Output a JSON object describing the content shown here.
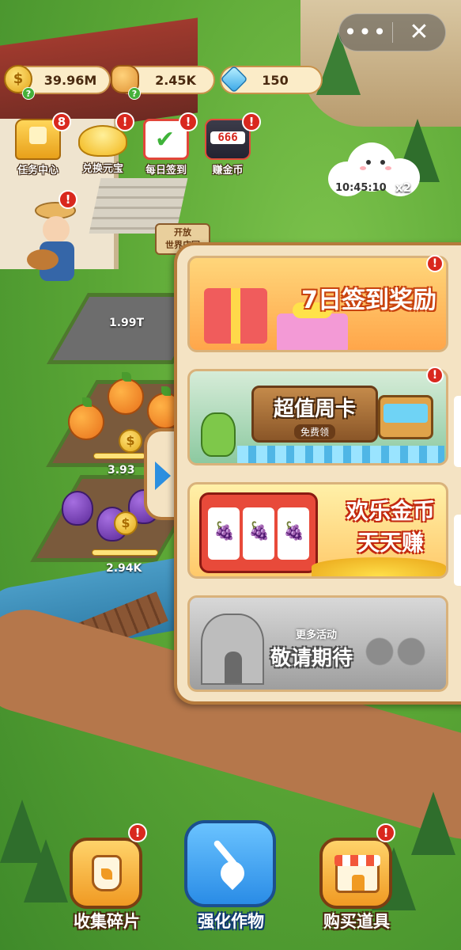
{
  "top_capsule": {
    "more_icon": "more-dots-icon",
    "close_icon": "close-icon"
  },
  "resources": {
    "gold": {
      "value": "39.96M",
      "icon": "gold-coin-icon"
    },
    "fertilizer": {
      "value": "2.45K",
      "icon": "fertilizer-bag-icon"
    },
    "gems": {
      "value": "150",
      "icon": "diamond-icon"
    }
  },
  "hud": [
    {
      "label": "任务中心",
      "badge": "8",
      "icon": "task-chest-icon"
    },
    {
      "label": "兑换元宝",
      "badge": "!",
      "icon": "gold-ingot-icon"
    },
    {
      "label": "每日签到",
      "badge": "!",
      "icon": "calendar-check-icon"
    },
    {
      "label": "赚金币",
      "badge": "!",
      "icon": "slot-machine-icon"
    }
  ],
  "farmer_badge": "!",
  "sign": {
    "line1": "开放",
    "line2": "世界庄园"
  },
  "cloud": {
    "timer": "10:45:10",
    "multiplier": "x2"
  },
  "plots": [
    {
      "value": "1.99T"
    },
    {
      "value": "3.93"
    },
    {
      "value": "2.94K"
    }
  ],
  "panel": {
    "cards": [
      {
        "title": "7日签到奖励",
        "badge": "!"
      },
      {
        "title": "超值周卡",
        "subtitle": "免费领",
        "badge": "!"
      },
      {
        "title_line1": "欢乐金币",
        "title_line2": "天天赚"
      },
      {
        "subtitle": "更多活动",
        "title": "敬请期待"
      }
    ]
  },
  "bottom_buttons": [
    {
      "label": "收集碎片",
      "badge": "!",
      "icon": "seed-jar-icon"
    },
    {
      "label": "强化作物",
      "icon": "shovel-icon"
    },
    {
      "label": "购买道具",
      "badge": "!",
      "icon": "shop-icon"
    }
  ],
  "colors": {
    "panel_bg": "#f4e3c3",
    "panel_border": "#b57a3c",
    "badge_red": "#d9281e",
    "arrow_blue": "#2c8fe0"
  }
}
